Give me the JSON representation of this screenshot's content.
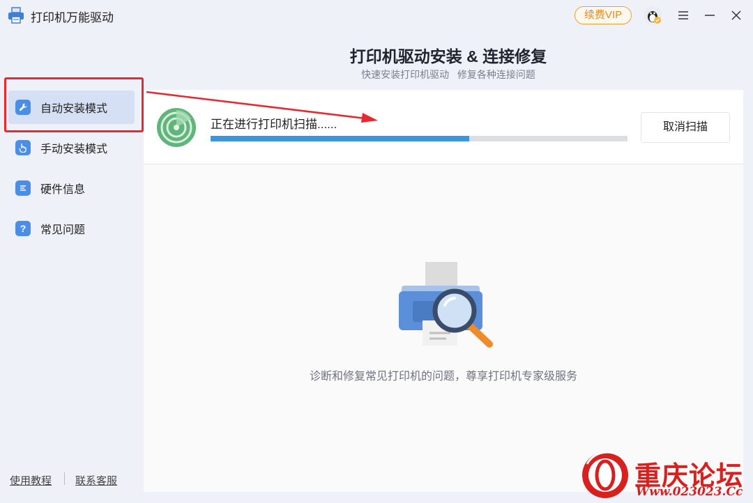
{
  "app": {
    "title": "打印机万能驱动",
    "vip_label": "续费VIP"
  },
  "header": {
    "title": "打印机驱动安装 & 连接修复",
    "subtitle": "快速安装打印机驱动   修复各种连接问题"
  },
  "sidebar": {
    "items": [
      {
        "label": "自动安装模式",
        "icon": "wrench-icon",
        "active": true
      },
      {
        "label": "手动安装模式",
        "icon": "hand-pointer-icon",
        "active": false
      },
      {
        "label": "硬件信息",
        "icon": "list-icon",
        "active": false
      },
      {
        "label": "常见问题",
        "icon": "question-icon",
        "active": false
      }
    ],
    "footer_links": [
      "使用教程",
      "联系客服"
    ]
  },
  "scan": {
    "status_text": "正在进行打印机扫描......",
    "progress_fraction": 0.62,
    "cancel_label": "取消扫描"
  },
  "main": {
    "empty_text": "诊断和修复常见打印机的问题，尊享打印机专家级服务"
  },
  "watermark": {
    "text": "重庆论坛",
    "url": "Www.023023.Cc"
  },
  "colors": {
    "accent": "#3b96db",
    "highlight": "#e8272e",
    "vip": "#e8891c",
    "watermark": "#d8201f"
  }
}
